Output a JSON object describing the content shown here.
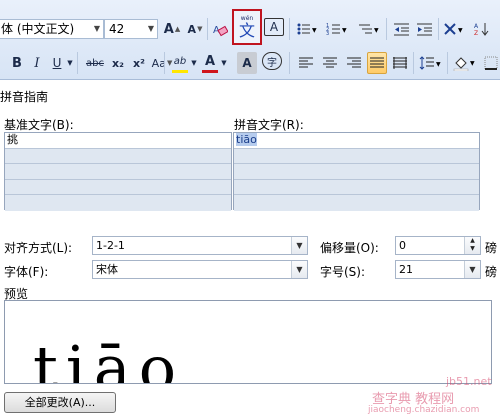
{
  "ribbon": {
    "font_name": "体 (中文正文)",
    "font_size": "42",
    "grow_font": "A",
    "shrink_font": "A",
    "phonetic_guide_top": "wén",
    "phonetic_guide_char": "文",
    "char_border": "A",
    "bold": "B",
    "italic": "I",
    "underline": "U",
    "strikethrough": "abc",
    "subscript": "x₂",
    "superscript": "x²",
    "change_case": "Aa",
    "highlight": "ab",
    "font_color": "A",
    "char_shading": "A",
    "enclose": "字"
  },
  "dialog": {
    "title": "拼音指南",
    "base_text_label": "基准文字(B):",
    "ruby_text_label": "拼音文字(R):",
    "base_rows": [
      "挑",
      "",
      "",
      "",
      ""
    ],
    "ruby_rows": [
      "tiāo",
      "",
      "",
      "",
      ""
    ],
    "alignment_label": "对齐方式(L):",
    "alignment_value": "1-2-1",
    "offset_label": "偏移量(O):",
    "offset_value": "0",
    "offset_unit": "磅",
    "font_label": "字体(F):",
    "font_value": "宋体",
    "size_label": "字号(S):",
    "size_value": "21",
    "size_unit": "磅",
    "preview_label": "预览",
    "preview_text": "tiāo",
    "change_all_button": "全部更改(A)..."
  },
  "watermark": {
    "line1": "查字典 教程网",
    "line2": "jiaocheng.chazidian.com",
    "line3": "jb51.net"
  }
}
